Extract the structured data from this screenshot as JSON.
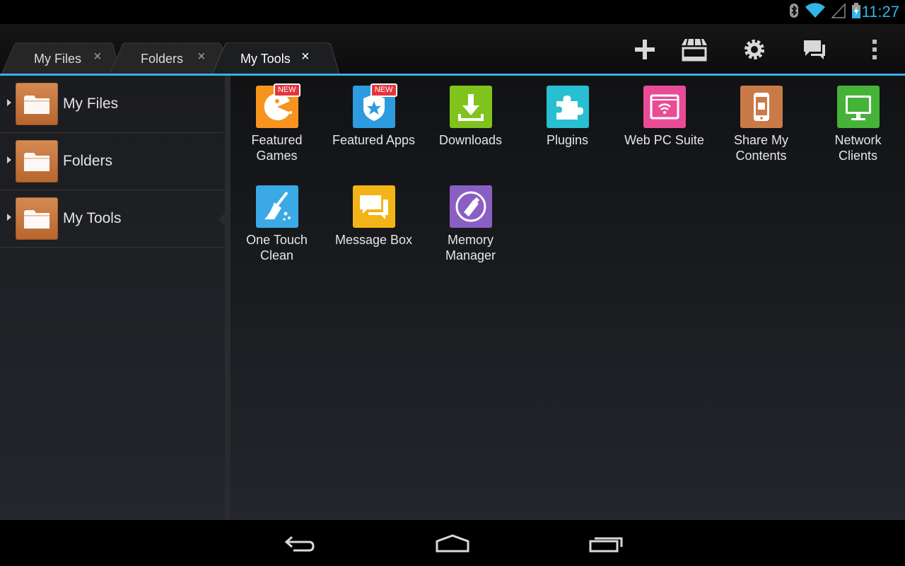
{
  "status_bar": {
    "time": "11:27",
    "icons": [
      "bluetooth-icon",
      "wifi-icon",
      "cell-signal-icon",
      "battery-charging-icon"
    ],
    "accent_color": "#33b5e5"
  },
  "tabs": [
    {
      "label": "My Files",
      "close": "×",
      "active": false
    },
    {
      "label": "Folders",
      "close": "×",
      "active": false
    },
    {
      "label": "My Tools",
      "close": "×",
      "active": true
    }
  ],
  "actions": [
    "add-icon",
    "store-icon",
    "settings-icon",
    "chat-icon",
    "overflow-menu-icon"
  ],
  "sidebar": {
    "items": [
      {
        "label": "My Files"
      },
      {
        "label": "Folders"
      },
      {
        "label": "My Tools",
        "selected": true
      }
    ]
  },
  "tools": [
    {
      "name": "Featured\nGames",
      "icon": "pacman-icon",
      "color": "#f7941d",
      "badge": "NEW"
    },
    {
      "name": "Featured Apps",
      "icon": "shield-star-icon",
      "color": "#2d9be0",
      "badge": "NEW"
    },
    {
      "name": "Downloads",
      "icon": "download-icon",
      "color": "#7fc31c"
    },
    {
      "name": "Plugins",
      "icon": "puzzle-icon",
      "color": "#27bfd1"
    },
    {
      "name": "Web PC Suite",
      "icon": "wifi-browser-icon",
      "color": "#e94c96"
    },
    {
      "name": "Share My\nContents",
      "icon": "phone-share-icon",
      "color": "#c97a47"
    },
    {
      "name": "Network\nClients",
      "icon": "monitor-icon",
      "color": "#46b338"
    },
    {
      "name": "One Touch\nClean",
      "icon": "broom-icon",
      "color": "#3aa9e6"
    },
    {
      "name": "Message Box",
      "icon": "message-icon",
      "color": "#f2b416"
    },
    {
      "name": "Memory\nManager",
      "icon": "memory-icon",
      "color": "#8a5fc4"
    }
  ],
  "nav": [
    "back-icon",
    "home-icon",
    "recent-apps-icon"
  ]
}
